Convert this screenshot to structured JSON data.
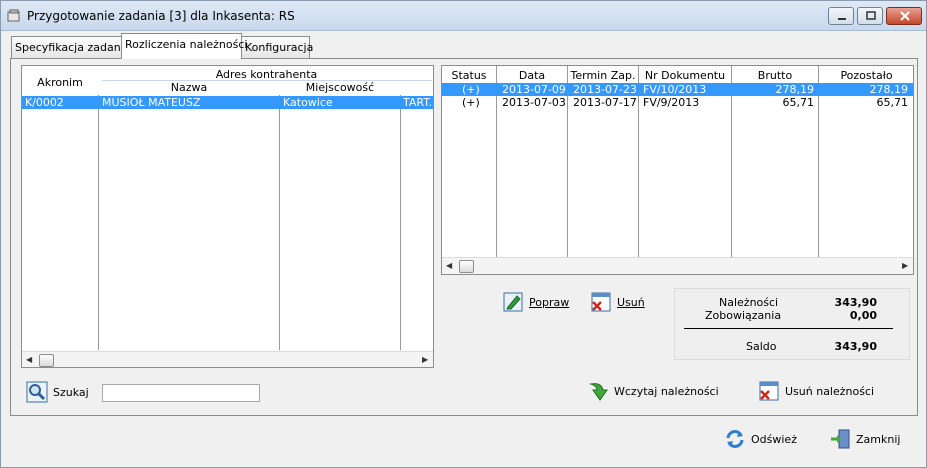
{
  "window": {
    "title": "Przygotowanie zadania [3] dla Inkasenta: RS"
  },
  "tabs": [
    {
      "label": "Specyfikacja zadania"
    },
    {
      "label": "Rozliczenia należności"
    },
    {
      "label": "Konfiguracja"
    }
  ],
  "left_grid": {
    "group_header": "Adres kontrahenta",
    "columns": [
      "Akronim",
      "Nazwa",
      "Miejscowość"
    ],
    "rows": [
      {
        "akronim": "K/0002",
        "nazwa": "MUSIOŁ MATEUSZ",
        "miejscowosc": "Katowice",
        "extra": "TART."
      }
    ]
  },
  "right_grid": {
    "columns": [
      "Status",
      "Data",
      "Termin Zap.",
      "Nr Dokumentu",
      "Brutto",
      "Pozostało"
    ],
    "rows": [
      {
        "status": "(+)",
        "data": "2013-07-09",
        "termin": "2013-07-23",
        "nr": "FV/10/2013",
        "brutto": "278,19",
        "pozostalo": "278,19"
      },
      {
        "status": "(+)",
        "data": "2013-07-03",
        "termin": "2013-07-17",
        "nr": "FV/9/2013",
        "brutto": "65,71",
        "pozostalo": "65,71"
      }
    ]
  },
  "actions": {
    "popraw": "Popraw",
    "usun": "Usuń",
    "szukaj": "Szukaj",
    "wczytaj": "Wczytaj należności",
    "usun_naleznosci": "Usuń należności",
    "odswiez": "Odśwież",
    "zamknij": "Zamknij"
  },
  "search": {
    "value": ""
  },
  "summary": {
    "naleznosci_label": "Należności",
    "naleznosci_value": "343,90",
    "zobowiazania_label": "Zobowiązania",
    "zobowiazania_value": "0,00",
    "saldo_label": "Saldo",
    "saldo_value": "343,90"
  },
  "colors": {
    "selection": "#3399ff"
  }
}
